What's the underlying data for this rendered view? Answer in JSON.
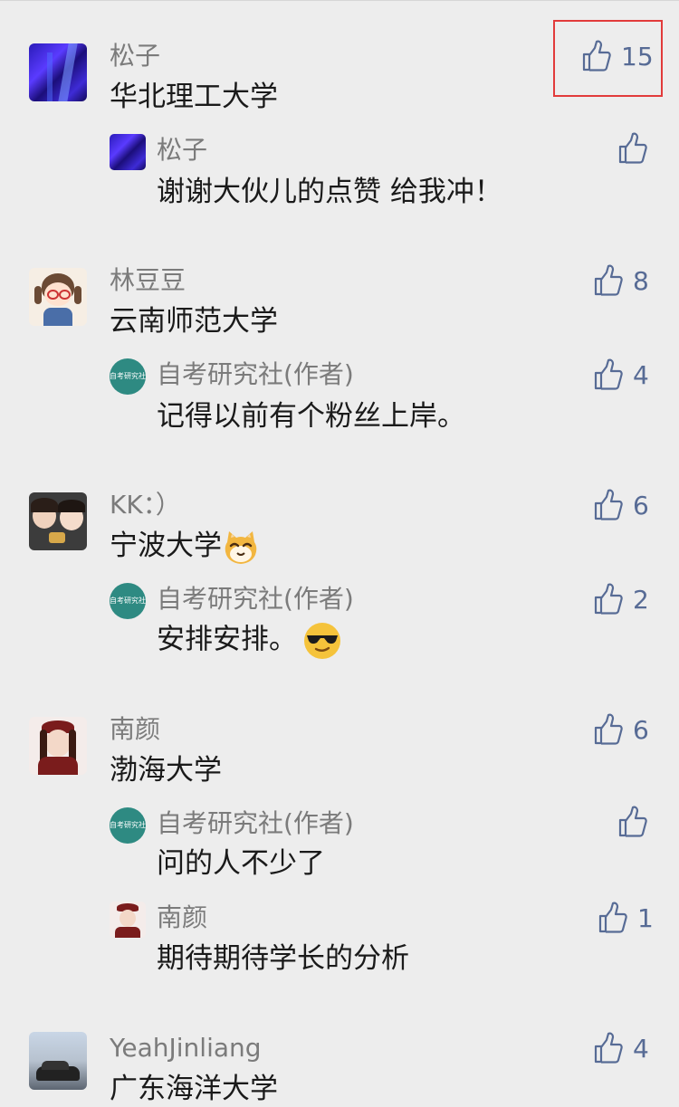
{
  "colors": {
    "background": "#ededed",
    "name": "#7b7b7b",
    "text": "#1a1a1a",
    "like": "#576b95",
    "highlight": "#e23b3b"
  },
  "comments": [
    {
      "name": "松子",
      "text": "华北理工大学",
      "likes": "15",
      "highlighted": true,
      "replies": [
        {
          "name": "松子",
          "text": "谢谢大伙儿的点赞 给我冲！",
          "likes": ""
        }
      ]
    },
    {
      "name": "林豆豆",
      "text": "云南师范大学",
      "likes": "8",
      "replies": [
        {
          "name": "自考研究社(作者)",
          "text": "记得以前有个粉丝上岸。",
          "likes": "4"
        }
      ]
    },
    {
      "name": "KK：）",
      "text": "宁波大学",
      "text_emoji": "cat-face-emoji",
      "likes": "6",
      "replies": [
        {
          "name": "自考研究社(作者)",
          "text": "安排安排。",
          "text_emoji": "sunglasses-emoji",
          "likes": "2"
        }
      ]
    },
    {
      "name": "南颜",
      "text": "渤海大学",
      "likes": "6",
      "replies": [
        {
          "name": "自考研究社(作者)",
          "text": "问的人不少了",
          "likes": ""
        },
        {
          "name": "南颜",
          "text": "期待期待学长的分析",
          "likes": "1"
        }
      ]
    },
    {
      "name": "YeahJinliang",
      "text": "广东海洋大学",
      "likes": "4",
      "replies": []
    }
  ],
  "author_avatar_text": "自考研究社",
  "icons": {
    "like": "thumbs-up-icon"
  }
}
